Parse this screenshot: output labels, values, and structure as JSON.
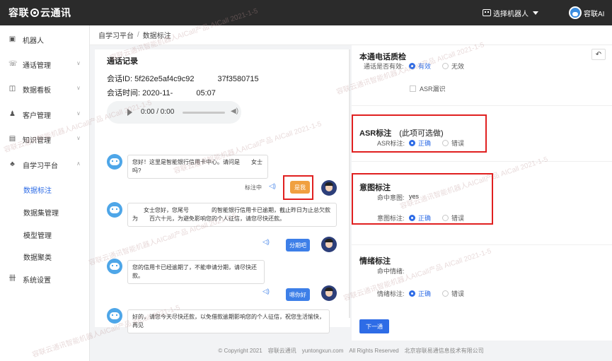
{
  "topbar": {
    "logo_left": "容联",
    "logo_right": "云通讯",
    "robot_select_label": "选择机器人",
    "user_name": "容联AI"
  },
  "sidebar": {
    "items": [
      {
        "label": "机器人",
        "icon": "robot-icon",
        "expandable": false
      },
      {
        "label": "通话管理",
        "icon": "phone-icon",
        "expandable": true
      },
      {
        "label": "数据看板",
        "icon": "dashboard-icon",
        "expandable": true
      },
      {
        "label": "客户管理",
        "icon": "users-icon",
        "expandable": true
      },
      {
        "label": "知识管理",
        "icon": "book-icon",
        "expandable": true
      },
      {
        "label": "自学习平台",
        "icon": "learning-icon",
        "expandable": true,
        "expanded": true
      },
      {
        "label": "系统设置",
        "icon": "settings-icon",
        "expandable": false
      }
    ],
    "subitems": [
      {
        "label": "数据标注",
        "active": true
      },
      {
        "label": "数据集管理",
        "active": false
      },
      {
        "label": "模型管理",
        "active": false
      },
      {
        "label": "数据聚类",
        "active": false
      }
    ]
  },
  "breadcrumb": {
    "parent": "自学习平台",
    "separator": "/",
    "current": "数据标注"
  },
  "call_record": {
    "title": "通话记录",
    "session_id": "会话ID: 5f262e5af4c9c92   37f3580715",
    "session_time": "会话时间: 2020-11-   05:07",
    "audio_time": "0:00 / 0:00"
  },
  "messages": [
    {
      "side": "bot",
      "text": "您好！这里是智能银行信用卡中心。请问是  女士吗?"
    },
    {
      "side": "user",
      "text": "是我",
      "tag": "标注中",
      "highlight": true
    },
    {
      "side": "bot",
      "text": "  女士您好，您尾号    的智能银行信用卡已逾期，截止昨日为止总欠款为  百六十元，为避免影响您的个人征信，请您尽快还款。"
    },
    {
      "side": "user",
      "text": "分期吧"
    },
    {
      "side": "bot",
      "text": "您的信用卡已经逾期了，不能申请分期，请尽快还款。"
    },
    {
      "side": "user",
      "text": "嗯你好"
    },
    {
      "side": "bot",
      "text": "好的，请您今天尽快还款，以免借款逾期影响您的个人征信，祝您生活愉快，再见"
    }
  ],
  "quality": {
    "title": "本通电话质检",
    "valid_label": "通话是否有效:",
    "valid_options": [
      "有效",
      "无效"
    ],
    "valid_selected": 0,
    "asr_error_label": "ASR漏识"
  },
  "asr": {
    "title": "ASR标注",
    "optional_note": "(此项可选做)",
    "field_label": "ASR标注:",
    "options": [
      "正确",
      "错误"
    ],
    "selected": 0
  },
  "intent": {
    "title": "意图标注",
    "hit_label": "命中意图:",
    "hit_value": "yes",
    "field_label": "意图标注:",
    "options": [
      "正确",
      "错误"
    ],
    "selected": 0
  },
  "emotion": {
    "title": "情绪标注",
    "hit_label": "命中情绪:",
    "hit_value": "",
    "field_label": "情绪标注:",
    "options": [
      "正确",
      "错误"
    ],
    "selected": 0
  },
  "next_button": "下一通",
  "footer": {
    "copyright": "© Copyright 2021",
    "brand": "容联云通讯",
    "domain": "yuntongxun.com",
    "rights": "All Rights Reserved",
    "company": "北京容联易通信息技术有限公司"
  },
  "watermark": {
    "text": "容联云通讯智能机器人AICall产品 AICall 2021-1-5"
  },
  "colors": {
    "accent": "#2e6ce6",
    "topbar": "#2b2b2b",
    "highlight": "#e02020",
    "user_bubble": "#3d7fe8",
    "active_bubble": "#f0a040"
  }
}
